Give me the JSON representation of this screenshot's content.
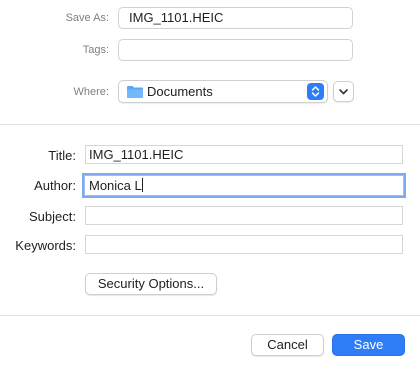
{
  "save_panel": {
    "save_as_label": "Save As:",
    "save_as_value": "IMG_1101.HEIC",
    "tags_label": "Tags:",
    "tags_value": "",
    "where_label": "Where:",
    "where_value": "Documents",
    "where_icon": "folder-icon"
  },
  "metadata": {
    "title_label": "Title:",
    "title_value": "IMG_1101.HEIC",
    "author_label": "Author:",
    "author_value": "Monica L",
    "subject_label": "Subject:",
    "subject_value": "",
    "keywords_label": "Keywords:",
    "keywords_value": "",
    "security_button": "Security Options..."
  },
  "footer": {
    "cancel_label": "Cancel",
    "save_label": "Save"
  },
  "colors": {
    "accent": "#2f7df6",
    "focus_ring": "#7eaaf2",
    "folder": "#5aa7f5"
  }
}
